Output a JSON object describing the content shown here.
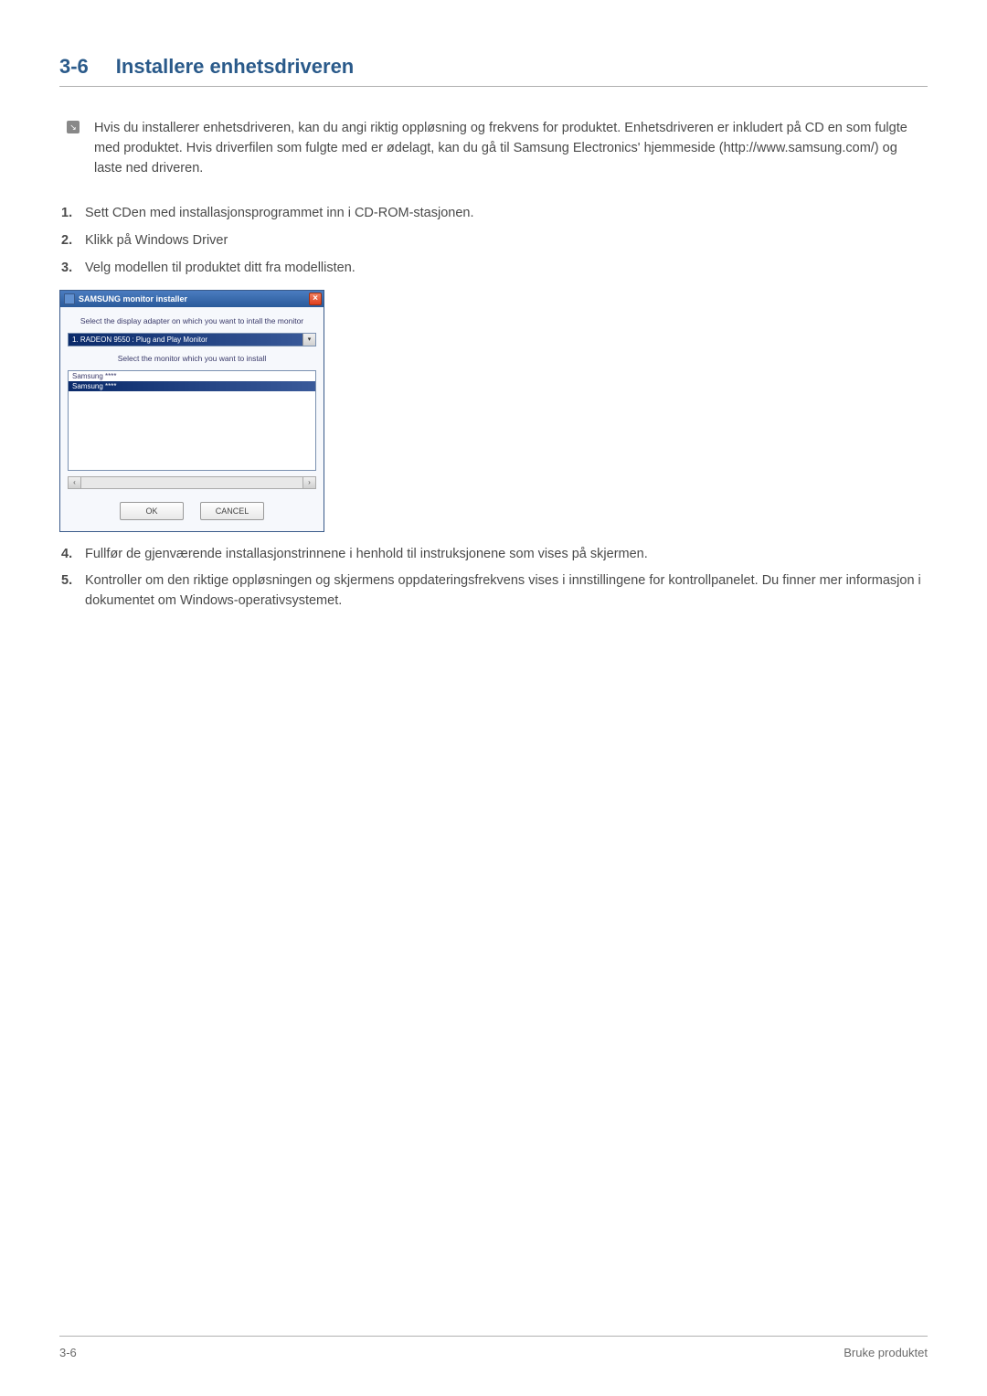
{
  "section": {
    "number": "3-6",
    "title": "Installere enhetsdriveren"
  },
  "note": "Hvis du installerer enhetsdriveren, kan du angi riktig oppløsning og frekvens for produktet. Enhetsdriveren er inkludert på CD en som fulgte med produktet. Hvis driverfilen som fulgte med er ødelagt, kan du gå til Samsung Electronics' hjemmeside (http://www.samsung.com/) og laste ned driveren.",
  "steps": {
    "s1": "Sett CDen med installasjonsprogrammet inn i CD-ROM-stasjonen.",
    "s2": "Klikk på Windows Driver",
    "s3": "Velg modellen til produktet ditt fra modellisten.",
    "s4": "Fullfør de gjenværende installasjonstrinnene i henhold til instruksjonene som vises på skjermen.",
    "s5": "Kontroller om den riktige oppløsningen og skjermens oppdateringsfrekvens vises i innstillingene for kontrollpanelet. Du finner mer informasjon i dokumentet om Windows-operativsystemet."
  },
  "installer": {
    "title": "SAMSUNG monitor installer",
    "close": "×",
    "adapter_label": "Select the display adapter on which you want to intall the monitor",
    "adapter_value": "1. RADEON 9550 : Plug and Play Monitor",
    "dropdown_arrow": "▾",
    "monitor_label": "Select the monitor which you want to install",
    "monitors": {
      "m0": "Samsung ****",
      "m1": "Samsung ****"
    },
    "scroll_left": "‹",
    "scroll_right": "›",
    "ok": "OK",
    "cancel": "CANCEL"
  },
  "footer": {
    "left": "3-6",
    "right": "Bruke produktet"
  }
}
